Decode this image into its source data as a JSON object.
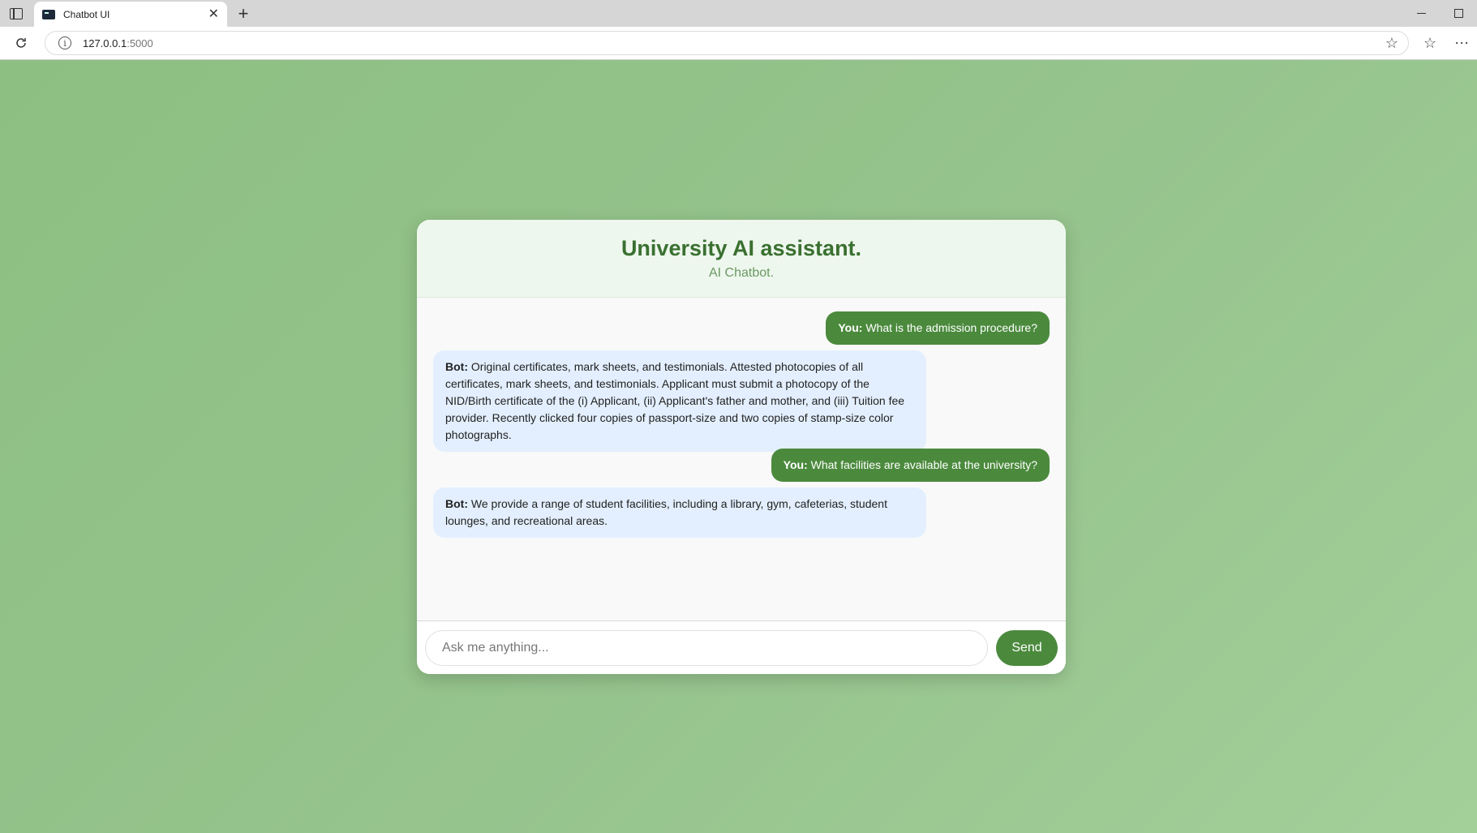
{
  "browser": {
    "tab_title": "Chatbot UI",
    "tab_close": "✕",
    "new_tab": "+",
    "url_host": "127.0.0.1",
    "url_port": ":5000",
    "icons": {
      "star": "☆",
      "favorites": "☆",
      "more": "⋯"
    }
  },
  "chat": {
    "title": "University AI assistant.",
    "subtitle": "AI Chatbot.",
    "messages": [
      {
        "sender": "You:",
        "text": " What is the admission procedure?"
      },
      {
        "sender": "Bot:",
        "text": " Original certificates, mark sheets, and testimonials. Attested photocopies of all certificates, mark sheets, and testimonials. Applicant must submit a photocopy of the NID/Birth certificate of the (i) Applicant, (ii) Applicant's father and mother, and (iii) Tuition fee provider. Recently clicked four copies of passport-size and two copies of stamp-size color photographs."
      },
      {
        "sender": "You:",
        "text": " What facilities are available at the university?"
      },
      {
        "sender": "Bot:",
        "text": " We provide a range of student facilities, including a library, gym, cafeterias, student lounges, and recreational areas."
      }
    ],
    "input_placeholder": "Ask me anything...",
    "input_value": "",
    "send_label": "Send"
  },
  "colors": {
    "background": "#8fbf85",
    "accent": "#4b8a3d",
    "title": "#3a7030",
    "bot_bubble": "#e3effe"
  }
}
